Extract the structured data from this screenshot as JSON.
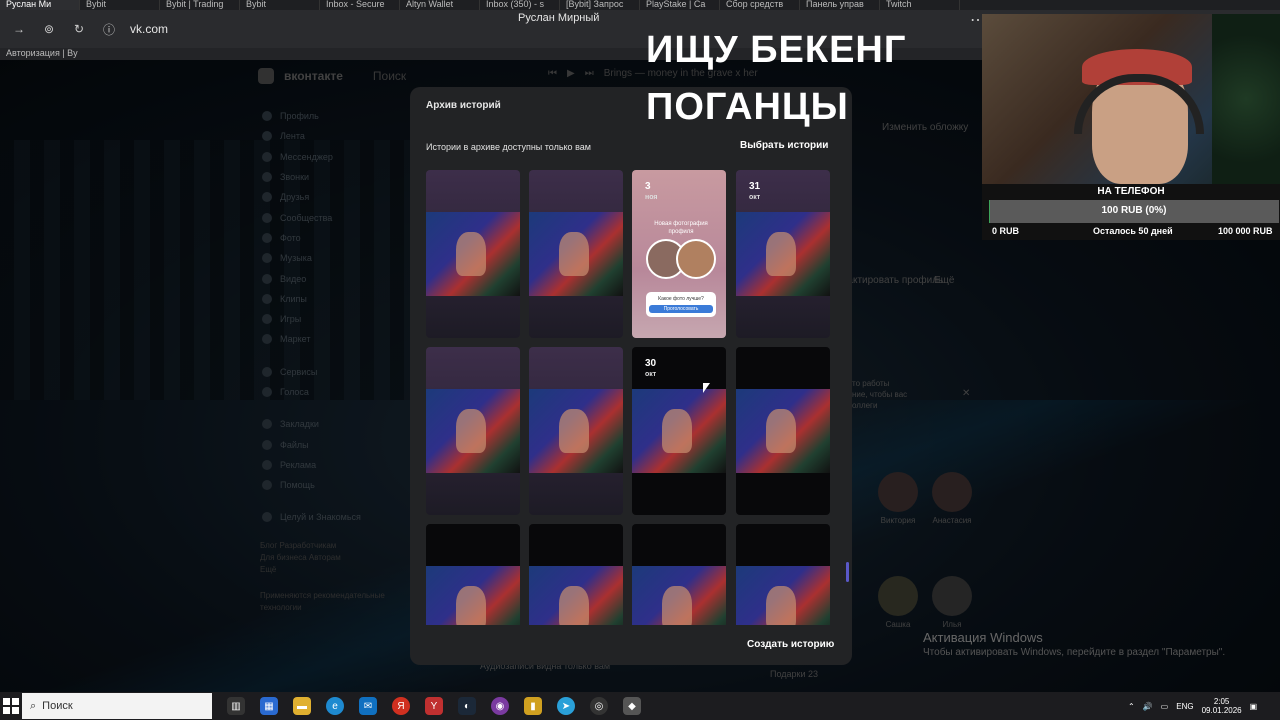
{
  "browser": {
    "tabs": [
      "Руслан Ми",
      "Bybit",
      "Bybit | Trading",
      "Bybit",
      "Inbox - Secure",
      "Altyn Wallet",
      "Inbox (350) - s",
      "[Bybit] Запрос",
      "PlayStake | Ca",
      "Сбор средств",
      "Панель управ",
      "Twitch"
    ],
    "url": "vk.com",
    "window_title": "Руслан Мирный",
    "bookmark": "Авторизация | By"
  },
  "vk": {
    "logo_text": "вконтакте",
    "search_placeholder": "Поиск",
    "player_track": "Brings — money in the grave x her",
    "sidebar": [
      "Профиль",
      "Лента",
      "Мессенджер",
      "Звонки",
      "Друзья",
      "Сообщества",
      "Фото",
      "Музыка",
      "Видео",
      "Клипы",
      "Игры",
      "Маркет",
      "Сервисы",
      "Голоса",
      "Закладки",
      "Файлы",
      "Реклама",
      "Помощь",
      "Целуй и Знакомься"
    ],
    "sidebar_footer": [
      "Блог  Разработчикам",
      "Для бизнеса  Авторам",
      "Ещё",
      "Применяются рекомендательные технологии"
    ],
    "edit_cover": "Изменить обложку",
    "edit_profile": "Редактировать профиль",
    "more": "Ещё",
    "work_hint": "то работы\nние, чтобы вас\nоллеги",
    "friends": [
      "Виктория",
      "Анастасия",
      "Сашка",
      "Илья"
    ],
    "friends_count_label": "Подарки  23",
    "audio_hint": "Аудиозаписи видна только вам"
  },
  "modal": {
    "title": "Архив историй",
    "note": "Истории в архиве доступны только вам",
    "select_button": "Выбрать истории",
    "create_button": "Создать историю",
    "stories": [
      {
        "kind": "video",
        "day": "",
        "month": ""
      },
      {
        "kind": "video",
        "day": "",
        "month": ""
      },
      {
        "kind": "profile",
        "day": "3",
        "month": "ноя"
      },
      {
        "kind": "video",
        "day": "31",
        "month": "окт"
      },
      {
        "kind": "video",
        "day": "",
        "month": ""
      },
      {
        "kind": "video",
        "day": "",
        "month": ""
      },
      {
        "kind": "video-dark",
        "day": "30",
        "month": "окт"
      },
      {
        "kind": "video-dark",
        "day": "",
        "month": ""
      },
      {
        "kind": "video-dark",
        "day": "",
        "month": ""
      },
      {
        "kind": "video-dark",
        "day": "",
        "month": ""
      },
      {
        "kind": "video-dark",
        "day": "",
        "month": ""
      },
      {
        "kind": "video-dark",
        "day": "",
        "month": ""
      }
    ],
    "profile_story": {
      "caption": "Новая фотография профиля",
      "question": "Какое фото лучше?",
      "reply": "Проголосовать"
    }
  },
  "stream": {
    "headline_line1": "ИЩУ БЕКЕНГ",
    "headline_line2": "ПОГАНЦЫ",
    "donation": {
      "title": "НА ТЕЛЕФОН",
      "progress_text": "100 RUB (0%)",
      "progress_fraction": 0.001,
      "min": "0 RUB",
      "remaining": "Осталось 50 дней",
      "max": "100 000 RUB"
    }
  },
  "windows": {
    "activation_title": "Активация Windows",
    "activation_text": "Чтобы активировать Windows, перейдите в раздел \"Параметры\".",
    "search_placeholder": "Поиск",
    "lang": "ENG",
    "time": "2:05",
    "date": "09.01.2026",
    "notifications": "2"
  },
  "colors": {
    "accent": "#3b7bd8",
    "scroll": "#5a58c8",
    "progress": "#3ea55a"
  }
}
